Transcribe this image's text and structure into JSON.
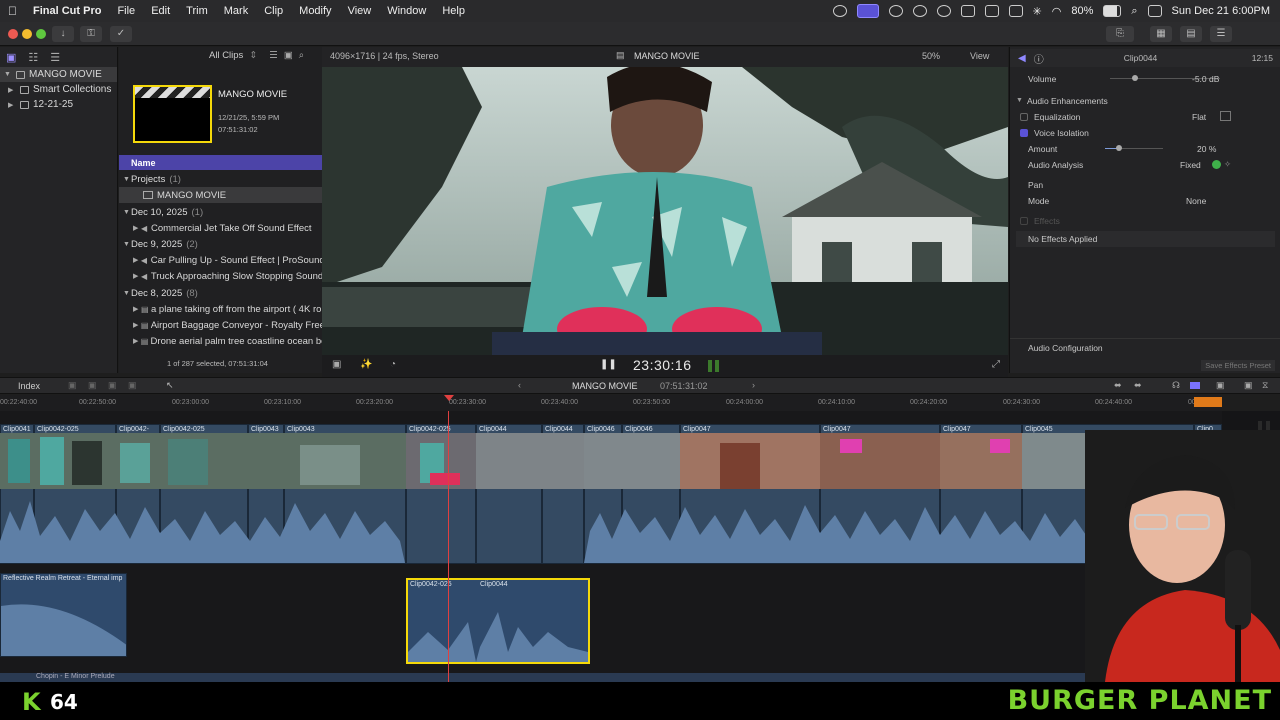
{
  "menubar": {
    "app_name": "Final Cut Pro",
    "items": [
      "File",
      "Edit",
      "Trim",
      "Mark",
      "Clip",
      "Modify",
      "View",
      "Window",
      "Help"
    ],
    "battery": "80%",
    "datetime": "Sun Dec 21  6:00PM"
  },
  "library": {
    "name": "MANGO MOVIE",
    "smart_collections": "Smart Collections",
    "event": "12-21-25"
  },
  "browser": {
    "filter": "All Clips",
    "project_title": "MANGO MOVIE",
    "project_date": "12/21/25, 5:59 PM",
    "project_duration": "07:51:31:02",
    "column_header": "Name",
    "groups": [
      {
        "label": "Projects",
        "count": "(1)",
        "items": [
          "MANGO MOVIE"
        ]
      },
      {
        "label": "Dec 10, 2025",
        "count": "(1)",
        "items": [
          "Commercial Jet Take Off Sound Effect"
        ]
      },
      {
        "label": "Dec 9, 2025",
        "count": "(2)",
        "items": [
          "Car Pulling Up - Sound Effect  |  ProSound",
          "Truck Approaching Slow Stopping Sound"
        ]
      },
      {
        "label": "Dec 8, 2025",
        "count": "(8)",
        "items": [
          "a plane taking off from the airport ( 4K ro",
          "Airport Baggage Conveyor - Royalty Free",
          "Drone aerial palm tree coastline ocean be"
        ]
      }
    ],
    "selection_status": "1 of 287 selected, 07:51:31:04"
  },
  "viewer": {
    "format": "4096×1716 | 24 fps, Stereo",
    "title": "MANGO MOVIE",
    "zoom": "50%",
    "view_menu": "View",
    "timecode": "23:30:16"
  },
  "inspector": {
    "clip_name": "Clip0044",
    "clip_duration": "12:15",
    "volume_label": "Volume",
    "volume_value": "-5.0  dB",
    "enhancements": "Audio Enhancements",
    "equalization_label": "Equalization",
    "equalization_value": "Flat",
    "voice_isolation": "Voice Isolation",
    "amount_label": "Amount",
    "amount_value": "20  %",
    "analysis_label": "Audio Analysis",
    "analysis_value": "Fixed",
    "pan_label": "Pan",
    "mode_label": "Mode",
    "mode_value": "None",
    "effects_label": "Effects",
    "no_effects": "No Effects Applied",
    "audio_config": "Audio Configuration",
    "save_preset": "Save Effects Preset"
  },
  "timeline": {
    "index_label": "Index",
    "project_name": "MANGO MOVIE",
    "project_duration": "07:51:31:02",
    "ruler_ticks": [
      "00:22:40:00",
      "00:22:50:00",
      "00:23:00:00",
      "00:23:10:00",
      "00:23:20:00",
      "00:23:30:00",
      "00:23:40:00",
      "00:23:50:00",
      "00:24:00:00",
      "00:24:10:00",
      "00:24:20:00",
      "00:24:30:00",
      "00:24:40:00",
      "00:24:50"
    ],
    "clips": [
      "Clip0041",
      "Clip0042-025",
      "Clip0042-",
      "Clip0042-025",
      "Clip0043",
      "Clip0043",
      "Clip0042-025",
      "Clip0044",
      "Clip0044",
      "Clip0046",
      "Clip0046",
      "Clip0047",
      "Clip0047",
      "Clip0047",
      "Clip0045",
      "Clip0"
    ],
    "music_clip": "Reflective Realm Retreat - Eternal imp",
    "connected_clips": [
      "Clip0042-025",
      "Clip0044"
    ],
    "bottom_clip": "Chopin - E Minor Prelude"
  },
  "overlay": {
    "counter_prefix": "K",
    "counter": "64",
    "brand": "BURGER PLANET"
  },
  "colors": {
    "accent": "#5a52d6",
    "selection_yellow": "#f5d90a",
    "playhead": "#e04040",
    "brand_green": "#7bd22e"
  }
}
